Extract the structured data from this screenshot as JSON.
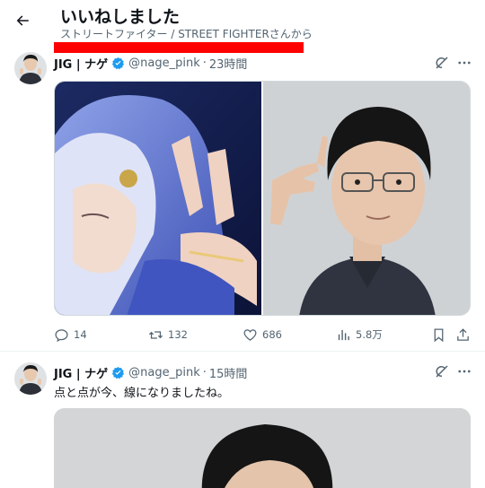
{
  "header": {
    "title": "いいねしました",
    "subtitle": "ストリートファイター / STREET FIGHTERさんから"
  },
  "tweets": [
    {
      "author": "JIG | ナゲ",
      "handle": "@nage_pink",
      "separator": "·",
      "time": "23時間",
      "text": "",
      "actions": {
        "replies": "14",
        "retweets": "132",
        "likes": "686",
        "views": "5.8万"
      }
    },
    {
      "author": "JIG | ナゲ",
      "handle": "@nage_pink",
      "separator": "·",
      "time": "15時間",
      "text": "点と点が今、線になりましたね。"
    }
  ],
  "colors": {
    "text": "#0f1419",
    "secondary": "#536471",
    "verified": "#1d9bf0",
    "redaction": "#ff0000"
  }
}
